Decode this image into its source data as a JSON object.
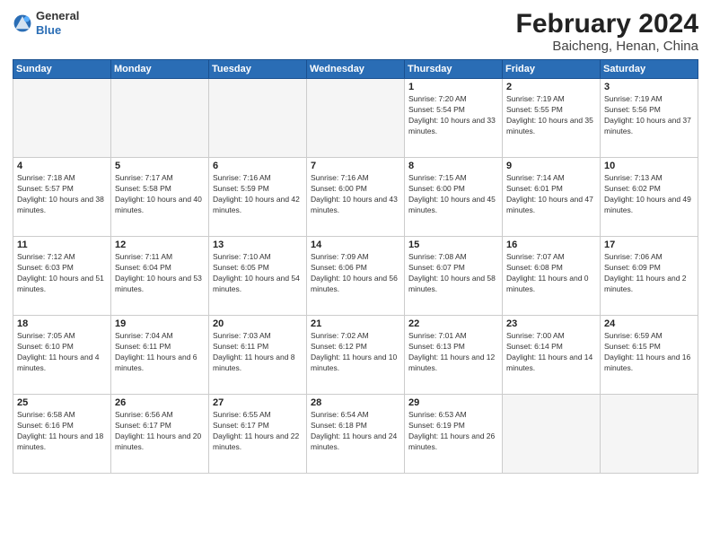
{
  "header": {
    "logo_general": "General",
    "logo_blue": "Blue",
    "title": "February 2024",
    "subtitle": "Baicheng, Henan, China"
  },
  "days_of_week": [
    "Sunday",
    "Monday",
    "Tuesday",
    "Wednesday",
    "Thursday",
    "Friday",
    "Saturday"
  ],
  "weeks": [
    [
      {
        "day": "",
        "empty": true
      },
      {
        "day": "",
        "empty": true
      },
      {
        "day": "",
        "empty": true
      },
      {
        "day": "",
        "empty": true
      },
      {
        "day": "1",
        "sunrise": "7:20 AM",
        "sunset": "5:54 PM",
        "daylight": "10 hours and 33 minutes."
      },
      {
        "day": "2",
        "sunrise": "7:19 AM",
        "sunset": "5:55 PM",
        "daylight": "10 hours and 35 minutes."
      },
      {
        "day": "3",
        "sunrise": "7:19 AM",
        "sunset": "5:56 PM",
        "daylight": "10 hours and 37 minutes."
      }
    ],
    [
      {
        "day": "4",
        "sunrise": "7:18 AM",
        "sunset": "5:57 PM",
        "daylight": "10 hours and 38 minutes."
      },
      {
        "day": "5",
        "sunrise": "7:17 AM",
        "sunset": "5:58 PM",
        "daylight": "10 hours and 40 minutes."
      },
      {
        "day": "6",
        "sunrise": "7:16 AM",
        "sunset": "5:59 PM",
        "daylight": "10 hours and 42 minutes."
      },
      {
        "day": "7",
        "sunrise": "7:16 AM",
        "sunset": "6:00 PM",
        "daylight": "10 hours and 43 minutes."
      },
      {
        "day": "8",
        "sunrise": "7:15 AM",
        "sunset": "6:00 PM",
        "daylight": "10 hours and 45 minutes."
      },
      {
        "day": "9",
        "sunrise": "7:14 AM",
        "sunset": "6:01 PM",
        "daylight": "10 hours and 47 minutes."
      },
      {
        "day": "10",
        "sunrise": "7:13 AM",
        "sunset": "6:02 PM",
        "daylight": "10 hours and 49 minutes."
      }
    ],
    [
      {
        "day": "11",
        "sunrise": "7:12 AM",
        "sunset": "6:03 PM",
        "daylight": "10 hours and 51 minutes."
      },
      {
        "day": "12",
        "sunrise": "7:11 AM",
        "sunset": "6:04 PM",
        "daylight": "10 hours and 53 minutes."
      },
      {
        "day": "13",
        "sunrise": "7:10 AM",
        "sunset": "6:05 PM",
        "daylight": "10 hours and 54 minutes."
      },
      {
        "day": "14",
        "sunrise": "7:09 AM",
        "sunset": "6:06 PM",
        "daylight": "10 hours and 56 minutes."
      },
      {
        "day": "15",
        "sunrise": "7:08 AM",
        "sunset": "6:07 PM",
        "daylight": "10 hours and 58 minutes."
      },
      {
        "day": "16",
        "sunrise": "7:07 AM",
        "sunset": "6:08 PM",
        "daylight": "11 hours and 0 minutes."
      },
      {
        "day": "17",
        "sunrise": "7:06 AM",
        "sunset": "6:09 PM",
        "daylight": "11 hours and 2 minutes."
      }
    ],
    [
      {
        "day": "18",
        "sunrise": "7:05 AM",
        "sunset": "6:10 PM",
        "daylight": "11 hours and 4 minutes."
      },
      {
        "day": "19",
        "sunrise": "7:04 AM",
        "sunset": "6:11 PM",
        "daylight": "11 hours and 6 minutes."
      },
      {
        "day": "20",
        "sunrise": "7:03 AM",
        "sunset": "6:11 PM",
        "daylight": "11 hours and 8 minutes."
      },
      {
        "day": "21",
        "sunrise": "7:02 AM",
        "sunset": "6:12 PM",
        "daylight": "11 hours and 10 minutes."
      },
      {
        "day": "22",
        "sunrise": "7:01 AM",
        "sunset": "6:13 PM",
        "daylight": "11 hours and 12 minutes."
      },
      {
        "day": "23",
        "sunrise": "7:00 AM",
        "sunset": "6:14 PM",
        "daylight": "11 hours and 14 minutes."
      },
      {
        "day": "24",
        "sunrise": "6:59 AM",
        "sunset": "6:15 PM",
        "daylight": "11 hours and 16 minutes."
      }
    ],
    [
      {
        "day": "25",
        "sunrise": "6:58 AM",
        "sunset": "6:16 PM",
        "daylight": "11 hours and 18 minutes."
      },
      {
        "day": "26",
        "sunrise": "6:56 AM",
        "sunset": "6:17 PM",
        "daylight": "11 hours and 20 minutes."
      },
      {
        "day": "27",
        "sunrise": "6:55 AM",
        "sunset": "6:17 PM",
        "daylight": "11 hours and 22 minutes."
      },
      {
        "day": "28",
        "sunrise": "6:54 AM",
        "sunset": "6:18 PM",
        "daylight": "11 hours and 24 minutes."
      },
      {
        "day": "29",
        "sunrise": "6:53 AM",
        "sunset": "6:19 PM",
        "daylight": "11 hours and 26 minutes."
      },
      {
        "day": "",
        "empty": true
      },
      {
        "day": "",
        "empty": true
      }
    ]
  ]
}
